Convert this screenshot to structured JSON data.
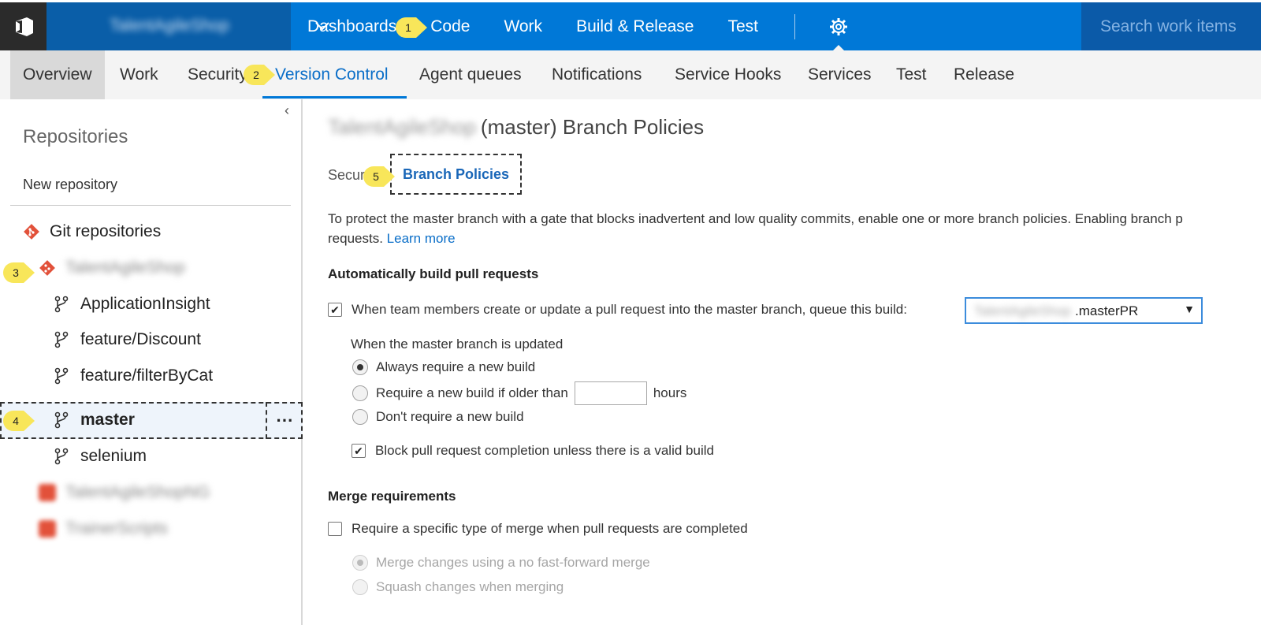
{
  "topbar": {
    "project_name": "TalentAgileShop",
    "nav": [
      "Dashboards",
      "Code",
      "Work",
      "Build & Release",
      "Test"
    ],
    "search_placeholder": "Search work items"
  },
  "subnav": {
    "items": [
      "Overview",
      "Work",
      "Security",
      "Version Control",
      "Agent queues",
      "Notifications",
      "Service Hooks",
      "Services",
      "Test",
      "Release"
    ],
    "active": "Version Control"
  },
  "sidebar": {
    "title": "Repositories",
    "new_repo": "New repository",
    "git_repos": "Git repositories",
    "repo_name": "TalentAgileShop",
    "branches": [
      "ApplicationInsight",
      "feature/Discount",
      "feature/filterByCat",
      "master",
      "selenium"
    ],
    "selected_branch": "master",
    "other_repos": [
      "TalentAgileShopNG",
      "TrainerScripts"
    ]
  },
  "callouts": [
    "1",
    "2",
    "3",
    "4",
    "5"
  ],
  "main": {
    "title_project": "TalentAgileShop",
    "title_suffix": "(master) Branch Policies",
    "tab_security": "Secur",
    "tab_branch_policies": "Branch Policies",
    "description_line1": "To protect the master branch with a gate that blocks inadvertent and low quality commits, enable one or more branch policies. Enabling branch p",
    "description_line2": "requests. ",
    "learn_more": "Learn more",
    "build_section": {
      "heading": "Automatically build pull requests",
      "build_checkbox_label": "When team members create or update a pull request into the master branch, queue this build:",
      "build_checked": true,
      "build_select_prefix": "TalentAgileShop",
      "build_select_value": ".masterPR",
      "when_updated": "When the master branch is updated",
      "options": [
        "Always require a new build",
        "Require a new build if older than",
        "Don't require a new build"
      ],
      "selected_option": 0,
      "hours_label": "hours",
      "hours_value": "",
      "block_label": "Block pull request completion unless there is a valid build",
      "block_checked": true
    },
    "merge_section": {
      "heading": "Merge requirements",
      "merge_checkbox_label": "Require a specific type of merge when pull requests are completed",
      "merge_checked": false,
      "options": [
        "Merge changes using a no fast-forward merge",
        "Squash changes when merging"
      ],
      "selected_option": 0
    }
  },
  "colors": {
    "accent": "#0078d7",
    "callout": "#f8e65a",
    "link": "#0a6ec8",
    "git": "#e2513a"
  }
}
